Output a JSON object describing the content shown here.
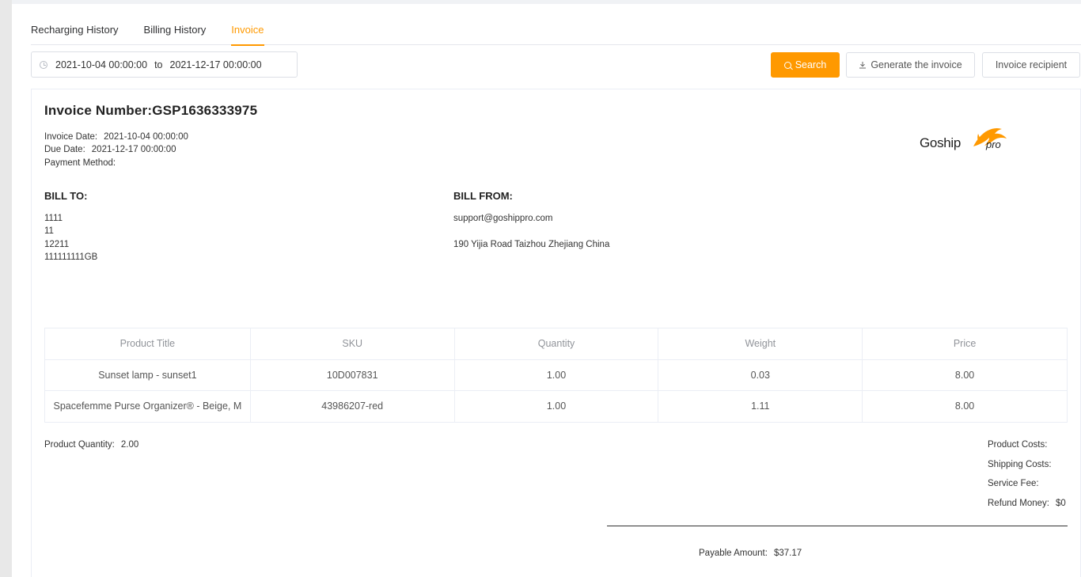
{
  "tabs": [
    {
      "label": "Recharging History",
      "active": false
    },
    {
      "label": "Billing History",
      "active": false
    },
    {
      "label": "Invoice",
      "active": true
    }
  ],
  "accent_color": "#ff9900",
  "date_range": {
    "start": "2021-10-04 00:00:00",
    "separator": "to",
    "end": "2021-12-17 00:00:00",
    "icon": "clock-icon"
  },
  "toolbar": {
    "search_label": "Search",
    "generate_label": "Generate the invoice",
    "recipient_label": "Invoice recipient"
  },
  "invoice": {
    "title": "Invoice Number:GSP1636333975",
    "invoice_date_label": "Invoice Date:",
    "invoice_date": "2021-10-04 00:00:00",
    "due_date_label": "Due Date:",
    "due_date": "2021-12-17 00:00:00",
    "payment_method_label": "Payment Method:",
    "payment_method": "",
    "logo_text": "Goship",
    "logo_suffix": "pro"
  },
  "bill_to": {
    "heading": "BILL TO:",
    "lines": [
      "1111",
      "11",
      "12211",
      "111111111GB"
    ]
  },
  "bill_from": {
    "heading": "BILL FROM:",
    "email": "support@goshippro.com",
    "address": "190 Yijia Road Taizhou Zhejiang China"
  },
  "table": {
    "headers": [
      "Product Title",
      "SKU",
      "Quantity",
      "Weight",
      "Price"
    ],
    "rows": [
      [
        "Sunset lamp - sunset1",
        "10D007831",
        "1.00",
        "0.03",
        "8.00"
      ],
      [
        "Spacefemme Purse Organizer® - Beige, M",
        "43986207-red",
        "1.00",
        "1.11",
        "8.00"
      ]
    ]
  },
  "summary": {
    "quantity_label": "Product Quantity:",
    "quantity": "2.00",
    "product_costs_label": "Product Costs:",
    "product_costs": "",
    "shipping_costs_label": "Shipping Costs:",
    "shipping_costs": "",
    "service_fee_label": "Service Fee:",
    "service_fee": "",
    "refund_label": "Refund Money:",
    "refund": "$0",
    "payable_label": "Payable Amount:",
    "payable": "$37.17"
  }
}
